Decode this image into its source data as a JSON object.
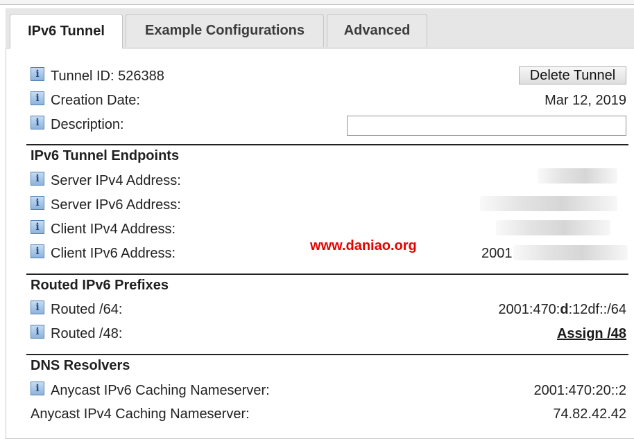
{
  "tabs": [
    {
      "label": "IPv6 Tunnel",
      "active": true
    },
    {
      "label": "Example Configurations",
      "active": false
    },
    {
      "label": "Advanced",
      "active": false
    }
  ],
  "tunnel": {
    "id_label": "Tunnel ID: 526388",
    "delete_button": "Delete Tunnel",
    "creation_label": "Creation Date:",
    "creation_value": "Mar 12, 2019",
    "description_label": "Description:",
    "description_value": ""
  },
  "endpoints": {
    "heading": "IPv6 Tunnel Endpoints",
    "server_ipv4_label": "Server IPv4 Address:",
    "server_ipv6_label": "Server IPv6 Address:",
    "client_ipv4_label": "Client IPv4 Address:",
    "client_ipv6_label": "Client IPv6 Address:",
    "client_ipv6_value_prefix": "2001"
  },
  "watermark": "www.daniao.org",
  "routed": {
    "heading": "Routed IPv6 Prefixes",
    "r64_label": "Routed /64:",
    "r64_value_a": "2001:470:",
    "r64_value_b": "d",
    "r64_value_c": ":12df::/64",
    "r48_label": "Routed /48:",
    "r48_link": "Assign /48"
  },
  "dns": {
    "heading": "DNS Resolvers",
    "anycast_v6_label": "Anycast IPv6 Caching Nameserver:",
    "anycast_v6_value": "2001:470:20::2",
    "anycast_v4_label": "Anycast IPv4 Caching Nameserver:",
    "anycast_v4_value": "74.82.42.42"
  },
  "icons": {
    "info": "info-icon"
  }
}
